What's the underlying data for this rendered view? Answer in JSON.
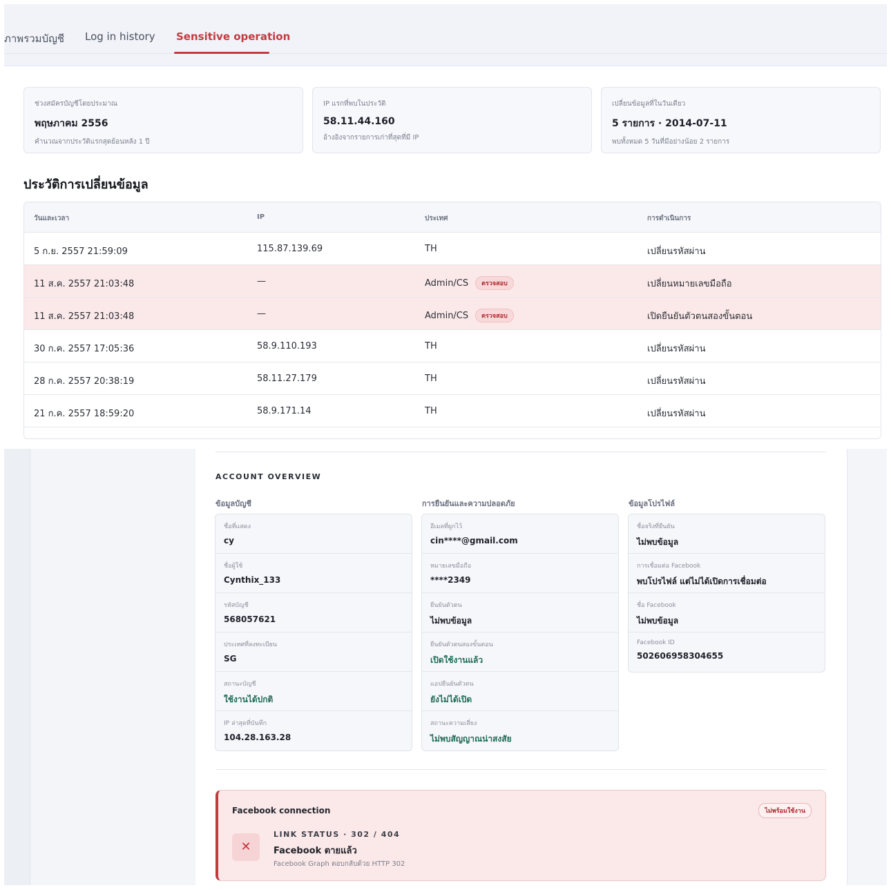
{
  "tabs": [
    {
      "label": "ภาพรวมบัญชี",
      "active": false
    },
    {
      "label": "Log in history",
      "active": false
    },
    {
      "label": "Sensitive operation",
      "active": true
    }
  ],
  "summary": [
    {
      "label": "ช่วงสมัครบัญชีโดยประมาณ",
      "value": "พฤษภาคม 2556",
      "sub": "คำนวณจากประวัติแรกสุดย้อนหลัง 1 ปี"
    },
    {
      "label": "IP แรกที่พบในประวัติ",
      "value": "58.11.44.160",
      "sub": "อ้างอิงจากรายการเก่าที่สุดที่มี IP"
    },
    {
      "label": "เปลี่ยนข้อมูลที่ในวันเดียว",
      "value": "5 รายการ · 2014-07-11",
      "sub": "พบทั้งหมด 5 วันที่มีอย่างน้อย 2 รายการ"
    }
  ],
  "history": {
    "title": "ประวัติการเปลี่ยนข้อมูล",
    "columns": [
      "วันและเวลา",
      "IP",
      "ประเทศ",
      "การดำเนินการ"
    ],
    "badge_label": "ตรวจสอบ",
    "rows": [
      {
        "datetime": "5 ก.ย. 2557 21:59:09",
        "ip": "115.87.139.69",
        "country": "TH",
        "action": "เปลี่ยนรหัสผ่าน",
        "flag": false
      },
      {
        "datetime": "11 ส.ค. 2557 21:03:48",
        "ip": "—",
        "country": "Admin/CS",
        "action": "เปลี่ยนหมายเลขมือถือ",
        "flag": true
      },
      {
        "datetime": "11 ส.ค. 2557 21:03:48",
        "ip": "—",
        "country": "Admin/CS",
        "action": "เปิดยืนยันตัวตนสองขั้นตอน",
        "flag": true
      },
      {
        "datetime": "30 ก.ค. 2557 17:05:36",
        "ip": "58.9.110.193",
        "country": "TH",
        "action": "เปลี่ยนรหัสผ่าน",
        "flag": false
      },
      {
        "datetime": "28 ก.ค. 2557 20:38:19",
        "ip": "58.11.27.179",
        "country": "TH",
        "action": "เปลี่ยนรหัสผ่าน",
        "flag": false
      },
      {
        "datetime": "21 ก.ค. 2557 18:59:20",
        "ip": "58.9.171.14",
        "country": "TH",
        "action": "เปลี่ยนรหัสผ่าน",
        "flag": false
      }
    ]
  },
  "overview": {
    "title": "ACCOUNT OVERVIEW",
    "columns": [
      {
        "heading": "ข้อมูลบัญชี",
        "items": [
          {
            "label": "ชื่อที่แสดง",
            "value": "cy",
            "status": false
          },
          {
            "label": "ชื่อผู้ใช้",
            "value": "Cynthix_133",
            "status": false
          },
          {
            "label": "รหัสบัญชี",
            "value": "568057621",
            "status": false
          },
          {
            "label": "ประเทศที่ลงทะเบียน",
            "value": "SG",
            "status": false
          },
          {
            "label": "สถานะบัญชี",
            "value": "ใช้งานได้ปกติ",
            "status": true
          },
          {
            "label": "IP ล่าสุดที่บันทึก",
            "value": "104.28.163.28",
            "status": false
          }
        ]
      },
      {
        "heading": "การยืนยันและความปลอดภัย",
        "items": [
          {
            "label": "อีเมลที่ผูกไว้",
            "value": "cin****@gmail.com",
            "status": false
          },
          {
            "label": "หมายเลขมือถือ",
            "value": "****2349",
            "status": false
          },
          {
            "label": "ยืนยันตัวตน",
            "value": "ไม่พบข้อมูล",
            "status": false
          },
          {
            "label": "ยืนยันตัวตนสองขั้นตอน",
            "value": "เปิดใช้งานแล้ว",
            "status": true
          },
          {
            "label": "แอปยืนยันตัวตน",
            "value": "ยังไม่ได้เปิด",
            "status": true
          },
          {
            "label": "สถานะความเสี่ยง",
            "value": "ไม่พบสัญญาณน่าสงสัย",
            "status": true
          }
        ]
      },
      {
        "heading": "ข้อมูลโปรไฟล์",
        "items": [
          {
            "label": "ชื่อจริงที่ยืนยัน",
            "value": "ไม่พบข้อมูล",
            "status": false
          },
          {
            "label": "การเชื่อมต่อ Facebook",
            "value": "พบโปรไฟล์ แต่ไม่ได้เปิดการเชื่อมต่อ",
            "status": false
          },
          {
            "label": "ชื่อ Facebook",
            "value": "ไม่พบข้อมูล",
            "status": false
          },
          {
            "label": "Facebook ID",
            "value": "502606958304655",
            "status": false
          }
        ]
      }
    ]
  },
  "facebook": {
    "title": "Facebook connection",
    "badge": "ไม่พร้อมใช้งาน",
    "icon": "close-icon",
    "status_line": "LINK STATUS · 302 / 404",
    "main": "Facebook ตายแล้ว",
    "sub": "Facebook Graph ตอบกลับด้วย HTTP 302"
  },
  "colors": {
    "accent": "#c33a3f",
    "flag_row": "#fbe9e9",
    "ok_green": "#1f6b55"
  }
}
